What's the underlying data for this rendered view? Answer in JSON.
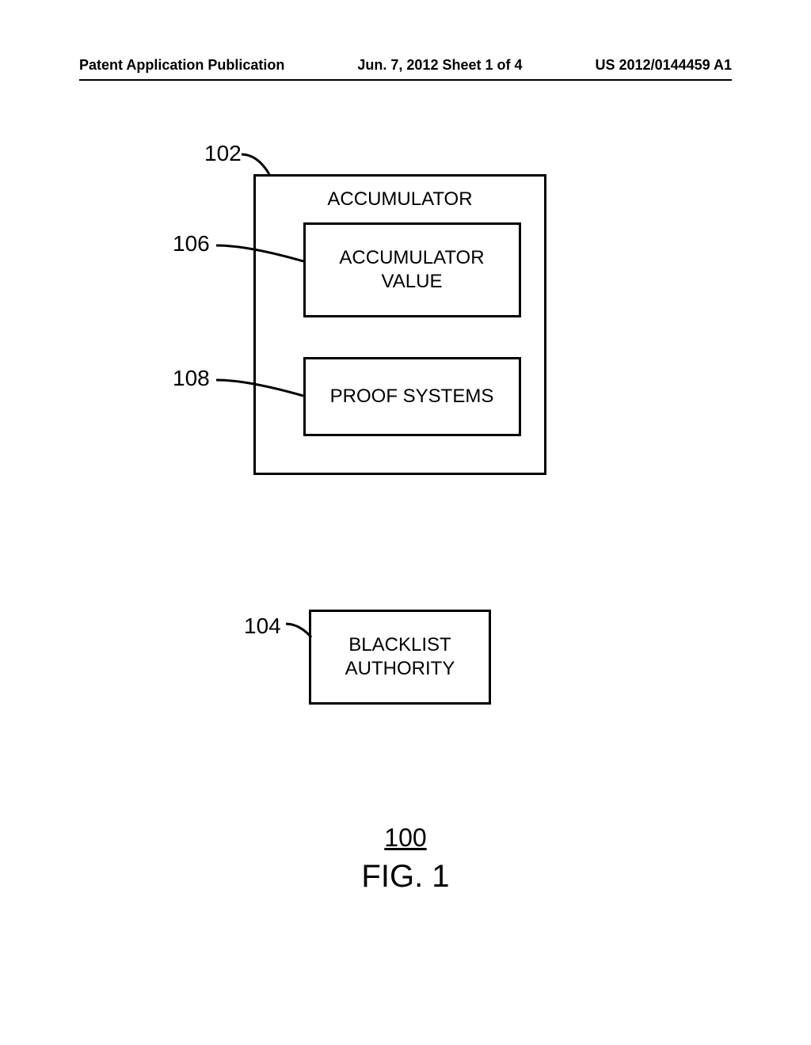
{
  "header": {
    "left": "Patent Application Publication",
    "center": "Jun. 7, 2012  Sheet 1 of 4",
    "right": "US 2012/0144459 A1"
  },
  "labels": {
    "l102": "102",
    "l106": "106",
    "l108": "108",
    "l104": "104"
  },
  "boxes": {
    "accumulator_title": "ACCUMULATOR",
    "accumulator_value_line1": "ACCUMULATOR",
    "accumulator_value_line2": "VALUE",
    "proof_systems": "PROOF SYSTEMS",
    "blacklist_line1": "BLACKLIST",
    "blacklist_line2": "AUTHORITY"
  },
  "figure": {
    "number": "100",
    "caption": "FIG. 1"
  }
}
